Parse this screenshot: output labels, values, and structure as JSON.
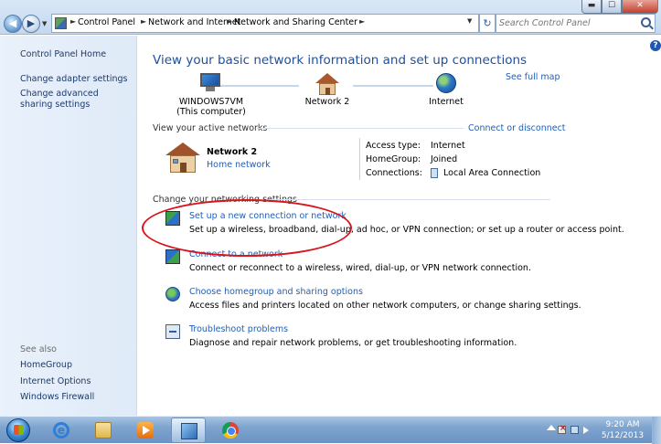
{
  "window": {
    "breadcrumbs": [
      "Control Panel",
      "Network and Internet",
      "Network and Sharing Center"
    ],
    "search_placeholder": "Search Control Panel",
    "controls": {
      "minimize": "▬",
      "maximize": "☐",
      "close": "✕"
    }
  },
  "sidebar": {
    "home": "Control Panel Home",
    "links": [
      "Change adapter settings",
      "Change advanced sharing settings"
    ],
    "see_also_label": "See also",
    "see_also": [
      "HomeGroup",
      "Internet Options",
      "Windows Firewall"
    ]
  },
  "main": {
    "heading": "View your basic network information and set up connections",
    "see_full_map": "See full map",
    "map": {
      "computer_name": "WINDOWS7VM",
      "computer_sub": "(This computer)",
      "network": "Network  2",
      "internet": "Internet"
    },
    "active_label": "View your active networks",
    "connect_disconnect": "Connect or disconnect",
    "active_network": {
      "name": "Network  2",
      "type": "Home network",
      "access_type_label": "Access type:",
      "access_type": "Internet",
      "homegroup_label": "HomeGroup:",
      "homegroup": "Joined",
      "connections_label": "Connections:",
      "connection": "Local Area Connection"
    },
    "change_label": "Change your networking settings",
    "tasks": [
      {
        "title": "Set up a new connection or network",
        "desc": "Set up a wireless, broadband, dial-up, ad hoc, or VPN connection; or set up a router or access point."
      },
      {
        "title": "Connect to a network",
        "desc": "Connect or reconnect to a wireless, wired, dial-up, or VPN network connection."
      },
      {
        "title": "Choose homegroup and sharing options",
        "desc": "Access files and printers located on other network computers, or change sharing settings."
      },
      {
        "title": "Troubleshoot problems",
        "desc": "Diagnose and repair network problems, or get troubleshooting information."
      }
    ]
  },
  "taskbar": {
    "time": "9:20 AM",
    "date": "5/12/2013"
  },
  "colors": {
    "link": "#1f5fb8",
    "heading": "#1e4fa0",
    "highlight_ellipse": "#d9141c"
  }
}
